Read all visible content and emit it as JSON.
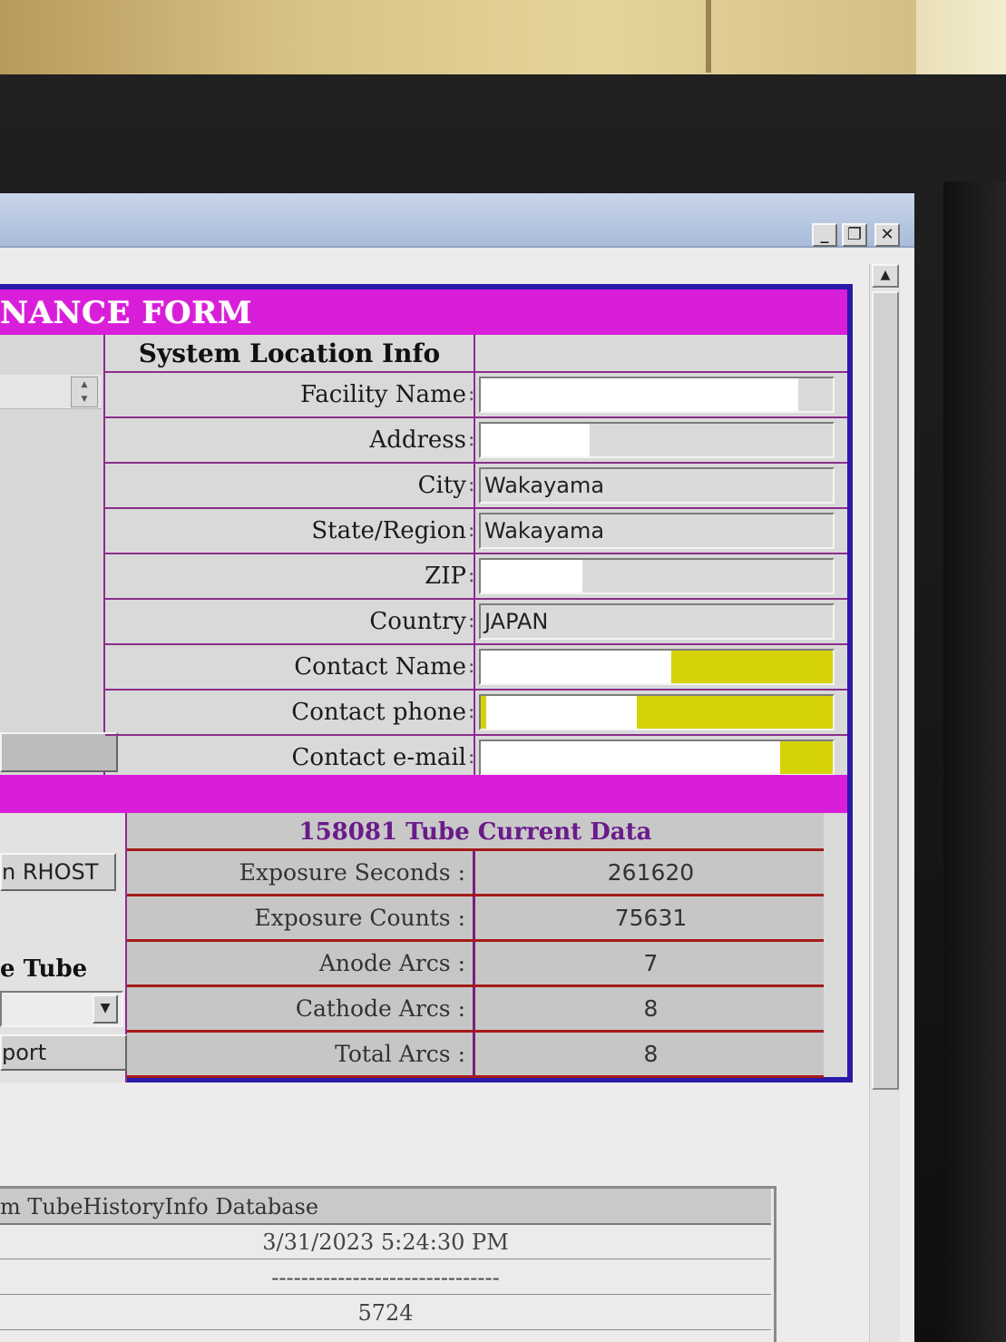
{
  "window": {
    "minimize_glyph": "_",
    "restore_glyph": "❐",
    "close_glyph": "✕",
    "scroll_up_glyph": "▲"
  },
  "form": {
    "header_title": "NANCE FORM"
  },
  "location": {
    "title": "System Location Info",
    "colon": ":",
    "fields": [
      {
        "label": "Facility Name",
        "value": ""
      },
      {
        "label": "Address",
        "value": ""
      },
      {
        "label": "City",
        "value": "Wakayama"
      },
      {
        "label": "State/Region",
        "value": "Wakayama"
      },
      {
        "label": "ZIP",
        "value": ""
      },
      {
        "label": "Country",
        "value": "JAPAN"
      },
      {
        "label": "Contact Name",
        "value": ""
      },
      {
        "label": "Contact phone",
        "value": ""
      },
      {
        "label": "Contact e-mail",
        "value": ""
      }
    ]
  },
  "left_panel": {
    "rhost_button": "n RHOST",
    "tube_label": "e Tube",
    "report_button": "port",
    "spin_up": "▲",
    "spin_down": "▼",
    "select_arrow": "▼"
  },
  "tube": {
    "title": "158081  Tube Current Data",
    "rows": [
      {
        "label": "Exposure Seconds :",
        "value": "261620"
      },
      {
        "label": "Exposure Counts :",
        "value": "75631"
      },
      {
        "label": "Anode Arcs :",
        "value": "7"
      },
      {
        "label": "Cathode Arcs :",
        "value": "8"
      },
      {
        "label": "Total Arcs :",
        "value": "8"
      }
    ]
  },
  "database": {
    "header": "m TubeHistoryInfo Database",
    "timestamp": "3/31/2023 5:24:30 PM",
    "separator": "-------------------------------",
    "value": "5724"
  },
  "colors": {
    "header_magenta": "#d81ed8",
    "frame_blue": "#2b1aa8",
    "row_border_purple": "#8b2d8b",
    "row_border_red": "#a51a1a",
    "required_yellow": "#d6d20a"
  }
}
